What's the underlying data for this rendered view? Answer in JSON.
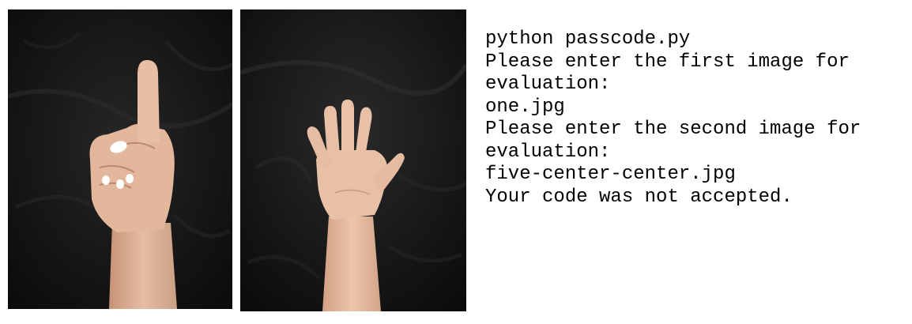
{
  "images": [
    {
      "name": "one-finger-photo",
      "subject": "hand-one-finger"
    },
    {
      "name": "five-finger-photo",
      "subject": "hand-open-palm"
    }
  ],
  "terminal": {
    "lines": [
      "python passcode.py",
      "Please enter the first image for",
      "evaluation:",
      "one.jpg",
      "Please enter the second image for",
      "evaluation:",
      "five-center-center.jpg",
      "Your code was not accepted."
    ]
  },
  "colors": {
    "background": "#ffffff",
    "text": "#000000",
    "fabric": "#111111",
    "skin": "#e2b79c",
    "nail_polish": "#ffffff"
  }
}
